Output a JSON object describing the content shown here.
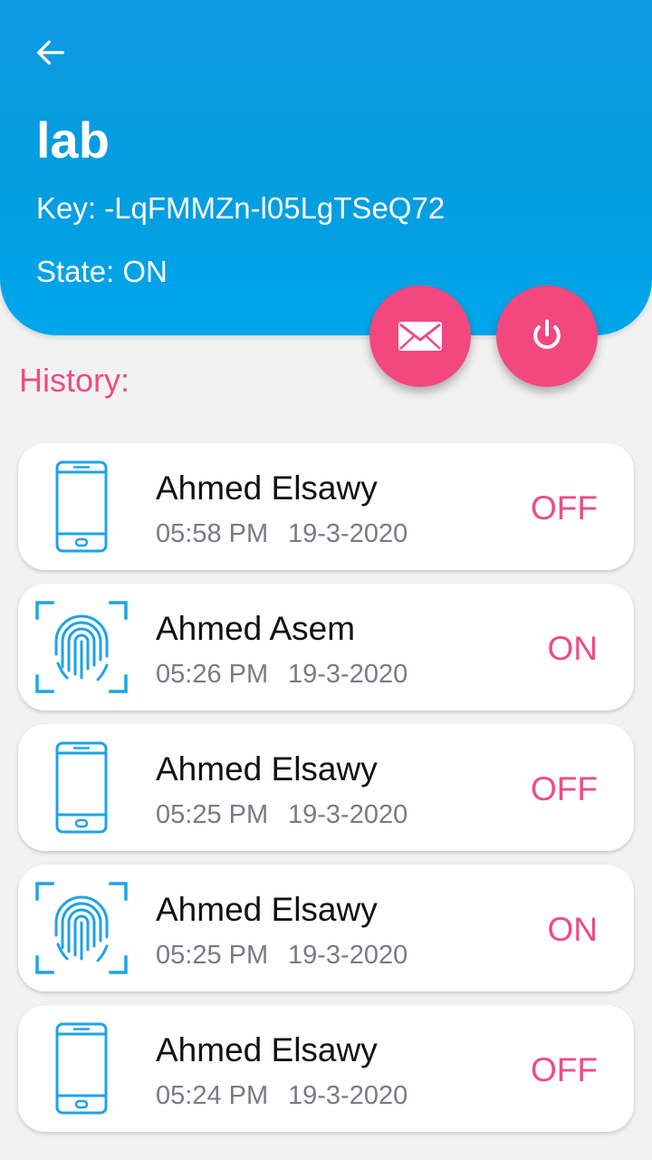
{
  "header": {
    "title": "lab",
    "key_text": "Key: -LqFMMZn-l05LgTSeQ72",
    "state_text": "State: ON",
    "back_icon": "arrow-left-icon",
    "background_color": "#039ddf"
  },
  "actions": {
    "mail_icon": "envelope-icon",
    "power_icon": "power-icon",
    "accent_color": "#f2487f"
  },
  "history": {
    "label": "History:",
    "items": [
      {
        "icon": "phone-icon",
        "name": "Ahmed Elsawy",
        "time": "05:58 PM",
        "date": "19-3-2020",
        "status": "OFF"
      },
      {
        "icon": "fingerprint-icon",
        "name": "Ahmed Asem",
        "time": "05:26 PM",
        "date": "19-3-2020",
        "status": "ON"
      },
      {
        "icon": "phone-icon",
        "name": "Ahmed Elsawy",
        "time": "05:25 PM",
        "date": "19-3-2020",
        "status": "OFF"
      },
      {
        "icon": "fingerprint-icon",
        "name": "Ahmed Elsawy",
        "time": "05:25 PM",
        "date": "19-3-2020",
        "status": "ON"
      },
      {
        "icon": "phone-icon",
        "name": "Ahmed Elsawy",
        "time": "05:24 PM",
        "date": "19-3-2020",
        "status": "OFF"
      }
    ]
  }
}
